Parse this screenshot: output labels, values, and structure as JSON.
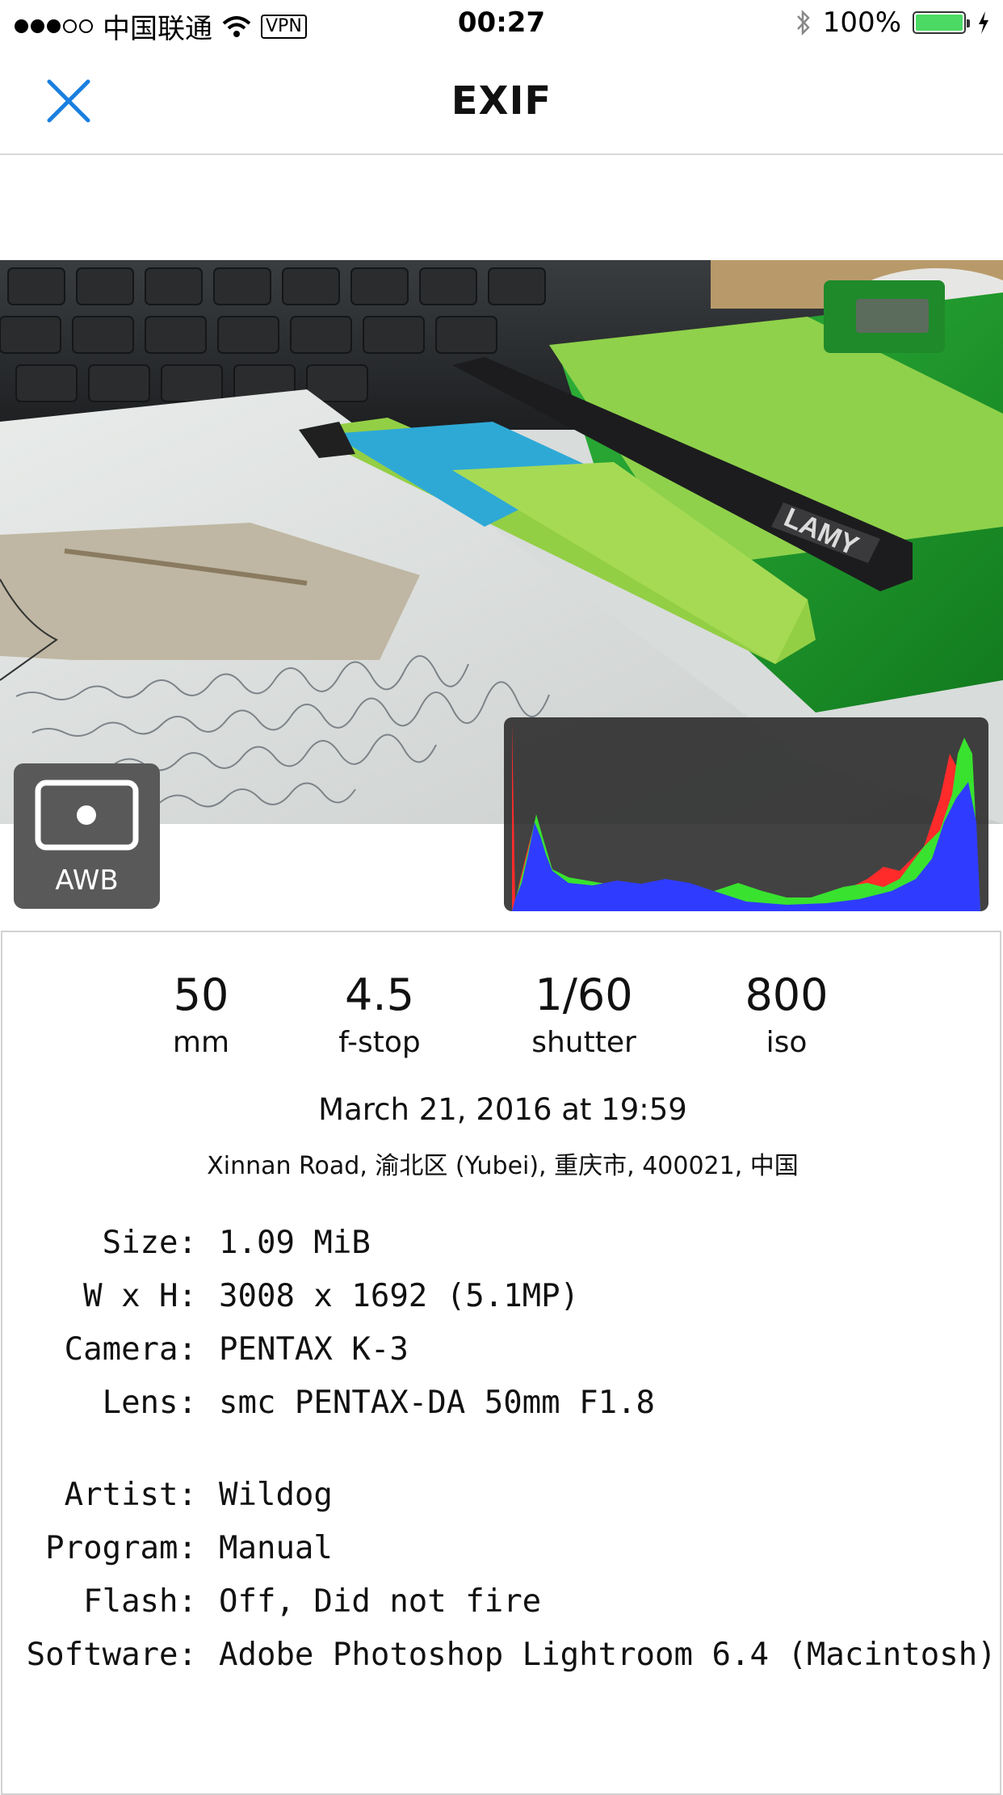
{
  "status_bar": {
    "carrier": "中国联通",
    "vpn": "VPN",
    "time": "00:27",
    "battery_percent": "100%",
    "battery_level": 1.0,
    "battery_color": "#4cd964"
  },
  "nav": {
    "title": "EXIF",
    "close_icon": "close-icon",
    "accent": "#1a7fe0"
  },
  "photo": {
    "subject": "notebook with pens"
  },
  "awb": {
    "label": "AWB",
    "icon": "white-balance-icon"
  },
  "histogram": {
    "channels": [
      "red",
      "green",
      "blue"
    ]
  },
  "stats": [
    {
      "value": "50",
      "label": "mm"
    },
    {
      "value": "4.5",
      "label": "f-stop"
    },
    {
      "value": "1/60",
      "label": "shutter"
    },
    {
      "value": "800",
      "label": "iso"
    }
  ],
  "date": "March 21, 2016 at 19:59",
  "location": "Xinnan Road, 渝北区 (Yubei), 重庆市, 400021, 中国",
  "details_group1": [
    {
      "key": "Size:",
      "value": "1.09 MiB"
    },
    {
      "key": "W x H:",
      "value": "3008 x 1692 (5.1MP)"
    },
    {
      "key": "Camera:",
      "value": "PENTAX K-3"
    },
    {
      "key": "Lens:",
      "value": "smc PENTAX-DA 50mm F1.8"
    }
  ],
  "details_group2": [
    {
      "key": "Artist:",
      "value": "Wildog"
    },
    {
      "key": "Program:",
      "value": "Manual"
    },
    {
      "key": "Flash:",
      "value": "Off, Did not fire"
    },
    {
      "key": "Software:",
      "value": "Adobe Photoshop Lightroom 6.4 (Macintosh)"
    }
  ]
}
